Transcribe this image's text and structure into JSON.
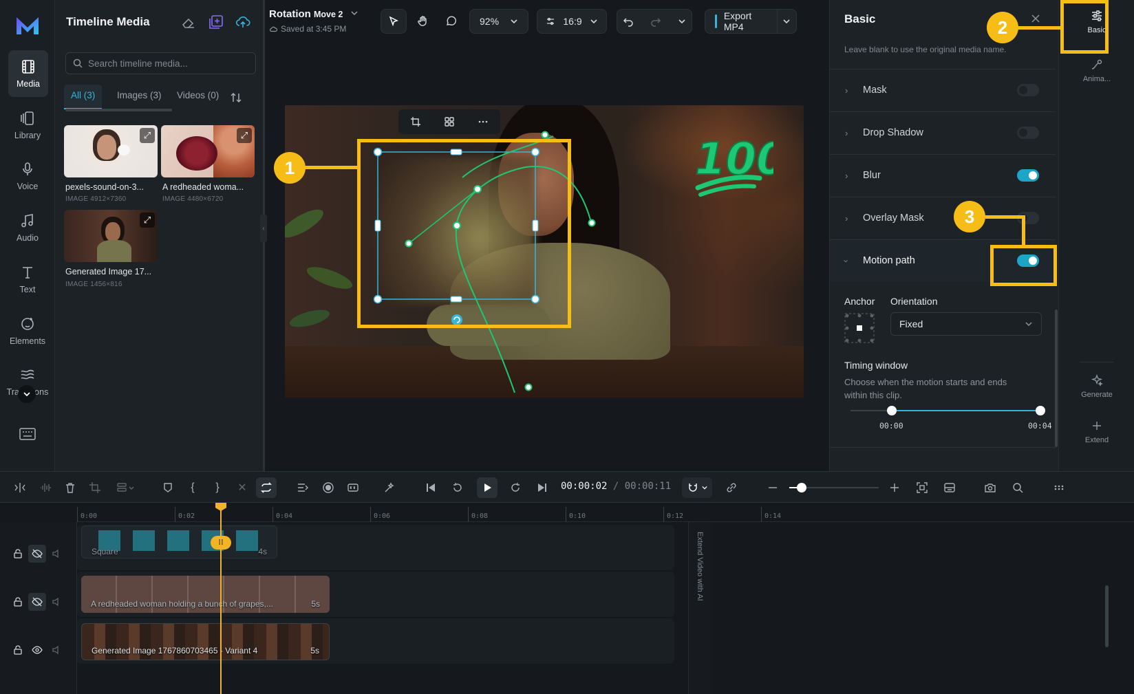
{
  "rail": {
    "items": [
      {
        "label": "Media",
        "icon": "film-icon"
      },
      {
        "label": "Library",
        "icon": "library-icon"
      },
      {
        "label": "Voice",
        "icon": "microphone-icon"
      },
      {
        "label": "Audio",
        "icon": "music-note-icon"
      },
      {
        "label": "Text",
        "icon": "text-icon"
      },
      {
        "label": "Elements",
        "icon": "elements-icon"
      },
      {
        "label": "Transitions",
        "icon": "transitions-icon"
      }
    ]
  },
  "media_panel": {
    "title": "Timeline Media",
    "search_placeholder": "Search timeline media...",
    "tabs": [
      {
        "label": "All (3)"
      },
      {
        "label": "Images (3)"
      },
      {
        "label": "Videos (0)"
      }
    ],
    "items": [
      {
        "name": "pexels-sound-on-3...",
        "meta": "IMAGE  4912×7360"
      },
      {
        "name": "A redheaded woma...",
        "meta": "IMAGE  4480×6720"
      },
      {
        "name": "Generated Image 17...",
        "meta": "IMAGE  1456×816"
      }
    ]
  },
  "project": {
    "name": "Rotation",
    "name_suffix": "Move 2",
    "save_status": "Saved at 3:45 PM"
  },
  "topbar": {
    "zoom": "92%",
    "ratio": "16:9",
    "export_label": "Export MP4"
  },
  "right_panel": {
    "title": "Basic",
    "hint": "Leave blank to use the original media name.",
    "sections": [
      {
        "label": "Mask",
        "enabled": false
      },
      {
        "label": "Drop Shadow",
        "enabled": false
      },
      {
        "label": "Blur",
        "enabled": true
      },
      {
        "label": "Overlay Mask",
        "enabled": false
      },
      {
        "label": "Motion path",
        "enabled": true
      }
    ],
    "anchor_label": "Anchor",
    "orientation_label": "Orientation",
    "orientation_value": "Fixed",
    "timing_title": "Timing window",
    "timing_desc": "Choose when the motion starts and ends within this clip.",
    "timing_start": "00:00",
    "timing_end": "00:04"
  },
  "far_rail": {
    "items": [
      {
        "label": "Basic",
        "icon": "sliders-icon"
      },
      {
        "label": "Anima...",
        "icon": "animation-icon"
      },
      {
        "label": "Generate",
        "icon": "sparkle-icon"
      },
      {
        "label": "Extend",
        "icon": "plus-icon"
      }
    ]
  },
  "timeline": {
    "current_time": "00:00:02",
    "total_time": "00:00:11",
    "ticks": [
      "0:00",
      "0:02",
      "0:04",
      "0:06",
      "0:08",
      "0:10",
      "0:12",
      "0:14"
    ],
    "extend_label": "Extend Video with AI",
    "clips": [
      {
        "name": "Square",
        "length": "4s"
      },
      {
        "name": "A redheaded woman holding a bunch of grapes,...",
        "length": "5s"
      },
      {
        "name": "Generated Image 1767860703465 - Variant 4",
        "length": "5s"
      }
    ]
  },
  "callouts": [
    "1",
    "2",
    "3"
  ],
  "colors": {
    "accent": "#35b6dd",
    "toggle_on": "#1da5c8",
    "highlight": "#f6bd16",
    "motion_path": "#1ec774",
    "playhead": "#f2b325"
  }
}
